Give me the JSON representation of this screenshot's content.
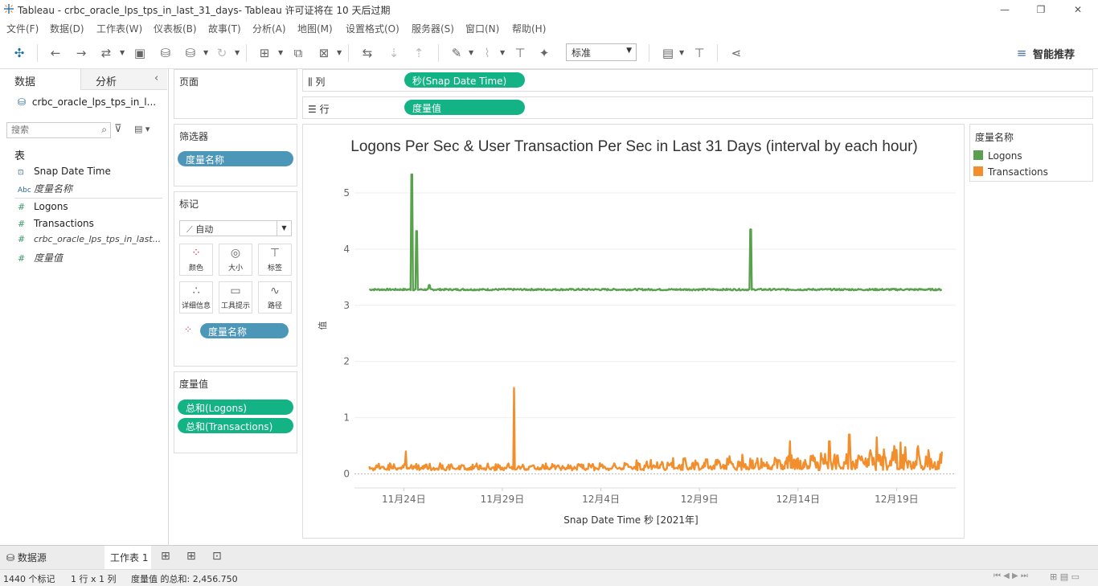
{
  "window": {
    "title": "Tableau - crbc_oracle_lps_tps_in_last_31_days- Tableau 许可证将在 10 天后过期",
    "min": "—",
    "restore": "❐",
    "close": "✕"
  },
  "menu": [
    "文件(F)",
    "数据(D)",
    "工作表(W)",
    "仪表板(B)",
    "故事(T)",
    "分析(A)",
    "地图(M)",
    "设置格式(O)",
    "服务器(S)",
    "窗口(N)",
    "帮助(H)"
  ],
  "toolbar": {
    "fit": "标准",
    "recommend": "智能推荐"
  },
  "left_pane": {
    "tabs": [
      "数据",
      "分析"
    ],
    "datasource": "crbc_oracle_lps_tps_in_l...",
    "search_placeholder": "搜索",
    "section": "表",
    "fields": [
      {
        "icon": "date-icon",
        "glyph": "⊡",
        "name": "Snap Date Time",
        "italic": false
      },
      {
        "icon": "abc-icon",
        "glyph": "Abc",
        "name": "度量名称",
        "italic": true
      },
      {
        "icon": "measure-icon",
        "glyph": "#",
        "name": "Logons",
        "italic": false
      },
      {
        "icon": "measure-icon",
        "glyph": "#",
        "name": "Transactions",
        "italic": false
      },
      {
        "icon": "measure-icon",
        "glyph": "#",
        "name": "crbc_oracle_lps_tps_in_last...",
        "italic": true
      },
      {
        "icon": "measure-icon",
        "glyph": "#",
        "name": "度量值",
        "italic": true
      }
    ]
  },
  "pages_panel": {
    "title": "页面"
  },
  "filters_panel": {
    "title": "筛选器",
    "pill": "度量名称"
  },
  "marks_panel": {
    "title": "标记",
    "type": "自动",
    "cells": [
      {
        "name": "color",
        "label": "颜色"
      },
      {
        "name": "size",
        "label": "大小"
      },
      {
        "name": "label",
        "label": "标签"
      },
      {
        "name": "detail",
        "label": "详细信息"
      },
      {
        "name": "tooltip",
        "label": "工具提示"
      },
      {
        "name": "path",
        "label": "路径"
      }
    ],
    "color_pill": "度量名称"
  },
  "measure_values_panel": {
    "title": "度量值",
    "pills": [
      "总和(Logons)",
      "总和(Transactions)"
    ]
  },
  "shelves": {
    "columns_label": "列",
    "columns_pill": "秒(Snap Date Time)",
    "rows_label": "行",
    "rows_pill": "度量值"
  },
  "legend": {
    "title": "度量名称",
    "items": [
      {
        "name": "Logons",
        "color": "#59a14f"
      },
      {
        "name": "Transactions",
        "color": "#f28e2b"
      }
    ]
  },
  "chart_data": {
    "type": "line",
    "title": "Logons Per Sec & User Transaction Per Sec in Last 31 Days (interval by each hour)",
    "xlabel": "Snap Date Time 秒 [2021年]",
    "ylabel": "值",
    "x_tick_labels": [
      "11月24日",
      "11月29日",
      "12月4日",
      "12月9日",
      "12月14日",
      "12月19日"
    ],
    "y_ticks": [
      0,
      1,
      2,
      3,
      4,
      5
    ],
    "ylim": [
      -0.25,
      5.5
    ],
    "xlim_days": [
      -0.5,
      30
    ],
    "grid": true,
    "series": [
      {
        "name": "Logons",
        "color": "#59a14f",
        "baseline": 3.28,
        "spikes": [
          {
            "x": 2.4,
            "y": 5.33
          },
          {
            "x": 2.65,
            "y": 4.32
          },
          {
            "x": 3.3,
            "y": 3.36
          },
          {
            "x": 19.6,
            "y": 4.35
          }
        ]
      },
      {
        "name": "Transactions",
        "color": "#f28e2b",
        "baseline": 0.06,
        "spikes": [
          {
            "x": 7.6,
            "y": 1.53
          },
          {
            "x": 2.1,
            "y": 0.4
          },
          {
            "x": 21.6,
            "y": 0.58
          },
          {
            "x": 23.6,
            "y": 0.58
          },
          {
            "x": 24.6,
            "y": 0.7
          },
          {
            "x": 26.0,
            "y": 0.65
          },
          {
            "x": 27.2,
            "y": 0.56
          }
        ]
      }
    ]
  },
  "sheet_tabs": {
    "datasource": "数据源",
    "sheet": "工作表 1"
  },
  "status": {
    "marks": "1440 个标记",
    "dims": "1 行 x 1 列",
    "sum": "度量值 的总和: 2,456.750"
  }
}
